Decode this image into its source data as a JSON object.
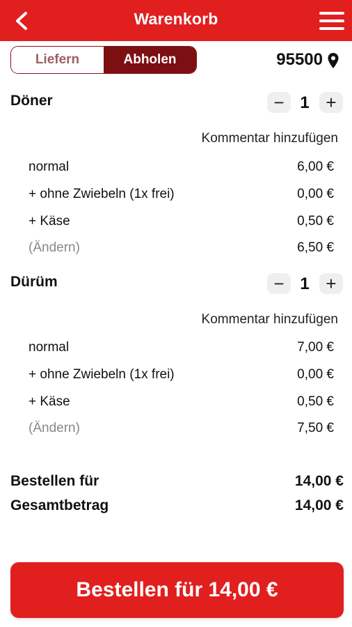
{
  "header": {
    "title": "Warenkorb",
    "back_icon": "chevron-left-icon",
    "menu_icon": "hamburger-menu-icon"
  },
  "mode_toggle": {
    "options": [
      "Liefern",
      "Abholen"
    ],
    "selected": "Abholen"
  },
  "location": {
    "zip": "95500",
    "icon": "map-pin-icon"
  },
  "items": [
    {
      "name": "Döner",
      "quantity": "1",
      "comment_label": "Kommentar hinzufügen",
      "lines": [
        {
          "label": "normal",
          "price": "6,00 €"
        },
        {
          "label": "+ ohne Zwiebeln (1x frei)",
          "price": "0,00 €"
        },
        {
          "label": "+ Käse",
          "price": "0,50 €"
        },
        {
          "label": "(Ändern)",
          "price": "6,50 €"
        }
      ]
    },
    {
      "name": "Dürüm",
      "quantity": "1",
      "comment_label": "Kommentar hinzufügen",
      "lines": [
        {
          "label": "normal",
          "price": "7,00 €"
        },
        {
          "label": "+ ohne Zwiebeln (1x frei)",
          "price": "0,00 €"
        },
        {
          "label": "+ Käse",
          "price": "0,50 €"
        },
        {
          "label": "(Ändern)",
          "price": "7,50 €"
        }
      ]
    }
  ],
  "summary": {
    "order_for_label": "Bestellen für",
    "order_for_value": "14,00 €",
    "total_label": "Gesamtbetrag",
    "total_value": "14,00 €"
  },
  "order_button": {
    "label": "Bestellen für 14,00 €"
  },
  "colors": {
    "brand_red": "#e11f1f",
    "toggle_active": "#7c0f12",
    "muted_text": "#888888"
  }
}
